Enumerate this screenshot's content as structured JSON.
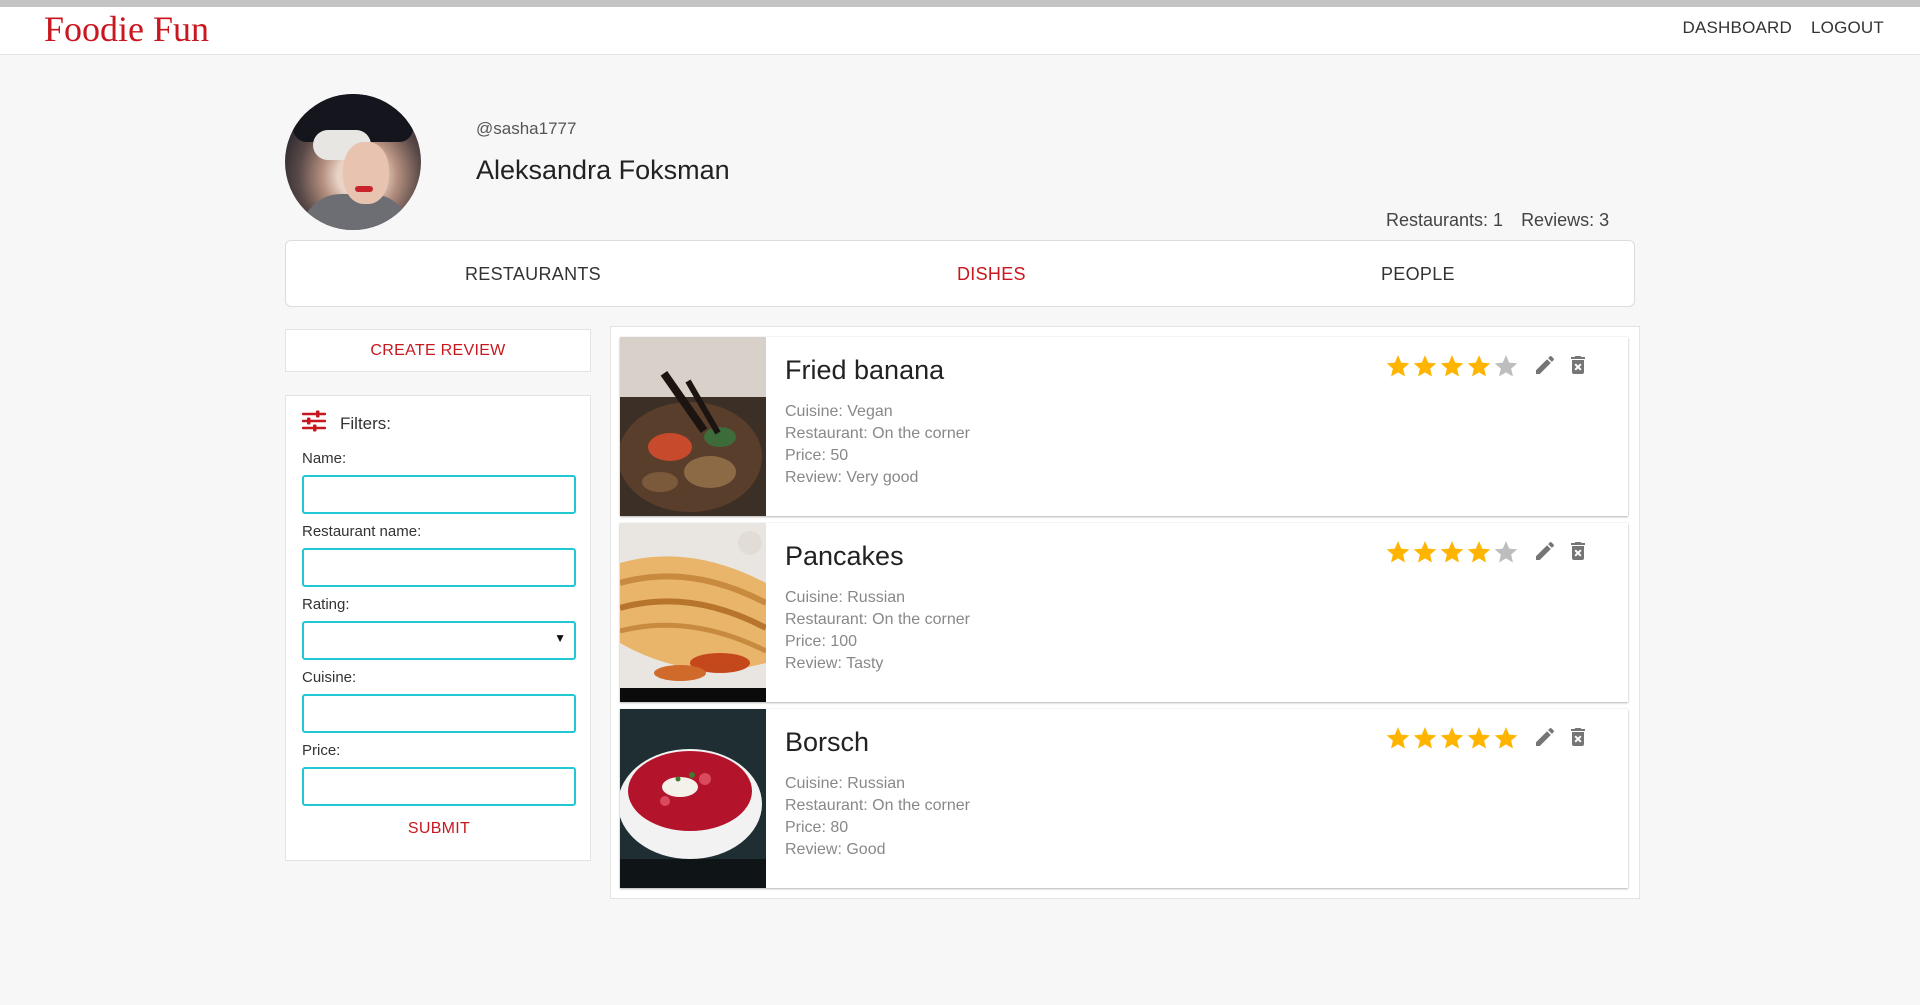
{
  "app": {
    "brand": "Foodie Fun"
  },
  "nav": {
    "dashboard": "DASHBOARD",
    "logout": "LOGOUT"
  },
  "profile": {
    "username": "@sasha1777",
    "full_name": "Aleksandra Foksman",
    "restaurants_stat": "Restaurants: 1",
    "reviews_stat": "Reviews: 3"
  },
  "tabs": [
    {
      "label": "RESTAURANTS",
      "active": false
    },
    {
      "label": "DISHES",
      "active": true
    },
    {
      "label": "PEOPLE",
      "active": false
    }
  ],
  "sidebar": {
    "create_review": "CREATE REVIEW",
    "filters_title": "Filters:",
    "fields": [
      {
        "label": "Name:",
        "value": ""
      },
      {
        "label": "Restaurant name:",
        "value": ""
      },
      {
        "label": "Rating:",
        "value": ""
      },
      {
        "label": "Cuisine:",
        "value": ""
      },
      {
        "label": "Price:",
        "value": ""
      }
    ],
    "submit": "SUBMIT"
  },
  "dishes": [
    {
      "name": "Fried banana",
      "cuisine": "Cuisine: Vegan",
      "restaurant": "Restaurant: On the corner",
      "price": "Price: 50",
      "review": "Review: Very good",
      "rating": 4
    },
    {
      "name": "Pancakes",
      "cuisine": "Cuisine: Russian",
      "restaurant": "Restaurant: On the corner",
      "price": "Price: 100",
      "review": "Review: Tasty",
      "rating": 4
    },
    {
      "name": "Borsch",
      "cuisine": "Cuisine: Russian",
      "restaurant": "Restaurant: On the corner",
      "price": "Price: 80",
      "review": "Review: Good",
      "rating": 5
    }
  ],
  "colors": {
    "accent": "#c8171e",
    "star_on": "#ffb400",
    "star_off": "#bdbdbd",
    "input_border": "#22c7d4"
  },
  "icons": {
    "filter": "tune-icon",
    "edit": "pencil-icon",
    "delete": "delete-icon",
    "star": "star-icon"
  }
}
